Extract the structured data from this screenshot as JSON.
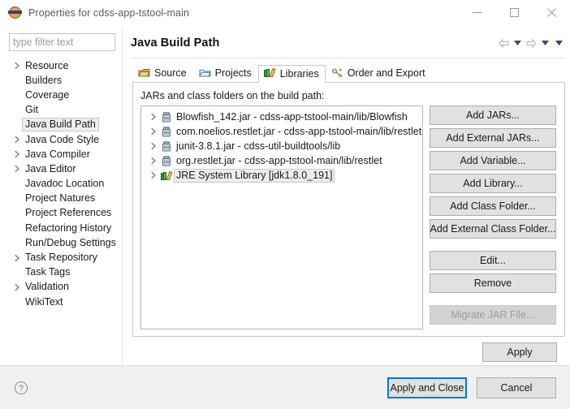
{
  "window": {
    "title": "Properties for cdss-app-tstool-main",
    "icon": "eclipse-globe-icon",
    "controls": [
      {
        "name": "minimize-button",
        "glyph": "minimize"
      },
      {
        "name": "maximize-button",
        "glyph": "maximize"
      },
      {
        "name": "close-button",
        "glyph": "close"
      }
    ]
  },
  "filter": {
    "placeholder": "type filter text",
    "value": ""
  },
  "tree": {
    "items": [
      {
        "label": "Resource",
        "expandable": true,
        "selected": false
      },
      {
        "label": "Builders",
        "expandable": false,
        "selected": false
      },
      {
        "label": "Coverage",
        "expandable": false,
        "selected": false
      },
      {
        "label": "Git",
        "expandable": false,
        "selected": false
      },
      {
        "label": "Java Build Path",
        "expandable": false,
        "selected": true
      },
      {
        "label": "Java Code Style",
        "expandable": true,
        "selected": false
      },
      {
        "label": "Java Compiler",
        "expandable": true,
        "selected": false
      },
      {
        "label": "Java Editor",
        "expandable": true,
        "selected": false
      },
      {
        "label": "Javadoc Location",
        "expandable": false,
        "selected": false
      },
      {
        "label": "Project Natures",
        "expandable": false,
        "selected": false
      },
      {
        "label": "Project References",
        "expandable": false,
        "selected": false
      },
      {
        "label": "Refactoring History",
        "expandable": false,
        "selected": false
      },
      {
        "label": "Run/Debug Settings",
        "expandable": false,
        "selected": false
      },
      {
        "label": "Task Repository",
        "expandable": true,
        "selected": false
      },
      {
        "label": "Task Tags",
        "expandable": false,
        "selected": false
      },
      {
        "label": "Validation",
        "expandable": true,
        "selected": false
      },
      {
        "label": "WikiText",
        "expandable": false,
        "selected": false
      }
    ]
  },
  "page": {
    "title": "Java Build Path",
    "nav": [
      {
        "name": "back-arrow-icon",
        "glyph": "left-arrow"
      },
      {
        "name": "back-dropdown-icon",
        "glyph": "caret-down"
      },
      {
        "name": "forward-arrow-icon",
        "glyph": "right-arrow"
      },
      {
        "name": "forward-dropdown-icon",
        "glyph": "caret-down"
      },
      {
        "name": "menu-dropdown-icon",
        "glyph": "caret-down-filled"
      }
    ]
  },
  "tabs": [
    {
      "label": "Source",
      "icon": "source-package-icon",
      "active": false
    },
    {
      "label": "Projects",
      "icon": "projects-folder-icon",
      "active": false
    },
    {
      "label": "Libraries",
      "icon": "libraries-books-icon",
      "active": true
    },
    {
      "label": "Order and Export",
      "icon": "order-export-icon",
      "active": false
    }
  ],
  "libraries": {
    "list_label": "JARs and class folders on the build path:",
    "entries": [
      {
        "label": "Blowfish_142.jar - cdss-app-tstool-main/lib/Blowfish",
        "icon": "jar-icon",
        "expandable": true,
        "selected": false
      },
      {
        "label": "com.noelios.restlet.jar - cdss-app-tstool-main/lib/restlet",
        "icon": "jar-icon",
        "expandable": true,
        "selected": false
      },
      {
        "label": "junit-3.8.1.jar - cdss-util-buildtools/lib",
        "icon": "jar-icon",
        "expandable": true,
        "selected": false
      },
      {
        "label": "org.restlet.jar - cdss-app-tstool-main/lib/restlet",
        "icon": "jar-icon",
        "expandable": true,
        "selected": false
      },
      {
        "label": "JRE System Library [jdk1.8.0_191]",
        "icon": "library-icon",
        "expandable": true,
        "selected": true
      }
    ],
    "buttons": [
      {
        "label": "Add JARs...",
        "name": "add-jars-button",
        "disabled": false
      },
      {
        "label": "Add External JARs...",
        "name": "add-external-jars-button",
        "disabled": false
      },
      {
        "label": "Add Variable...",
        "name": "add-variable-button",
        "disabled": false
      },
      {
        "label": "Add Library...",
        "name": "add-library-button",
        "disabled": false
      },
      {
        "label": "Add Class Folder...",
        "name": "add-class-folder-button",
        "disabled": false
      },
      {
        "label": "Add External Class Folder...",
        "name": "add-external-class-folder-button",
        "disabled": false
      }
    ],
    "buttons2": [
      {
        "label": "Edit...",
        "name": "edit-button",
        "disabled": false
      },
      {
        "label": "Remove",
        "name": "remove-button",
        "disabled": false
      }
    ],
    "buttons3": [
      {
        "label": "Migrate JAR File...",
        "name": "migrate-jar-file-button",
        "disabled": true
      }
    ]
  },
  "footer": {
    "apply_label": "Apply",
    "help_icon": "help-question-icon",
    "apply_and_close_label": "Apply and Close",
    "cancel_label": "Cancel"
  },
  "colors": {
    "accent": "#0078d7",
    "selection_bg": "#ededed",
    "button_face": "#e1e1e1",
    "dialog_bg": "#f0f0f0",
    "jar_icon": "#8fa2b5",
    "library_icon_green": "#3f8f3f",
    "folder_icon_blue": "#5b8bbf",
    "package_icon_tan": "#c8922e"
  }
}
